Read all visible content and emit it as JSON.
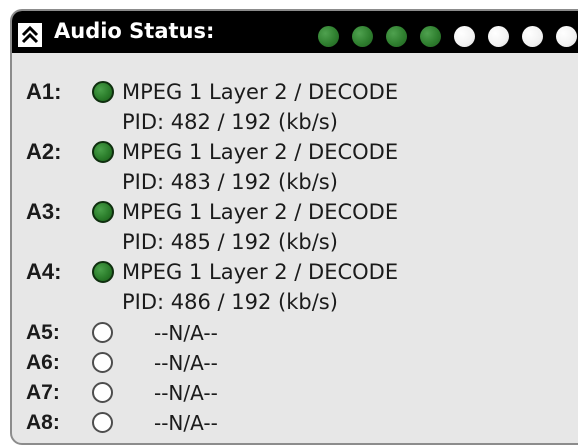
{
  "header": {
    "title": "Audio Status:",
    "indicators": [
      {
        "state": "on"
      },
      {
        "state": "on"
      },
      {
        "state": "on"
      },
      {
        "state": "on"
      },
      {
        "state": "off"
      },
      {
        "state": "off"
      },
      {
        "state": "off"
      },
      {
        "state": "off"
      }
    ]
  },
  "channels": [
    {
      "label": "A1:",
      "state": "on",
      "line1": "MPEG 1 Layer 2 / DECODE",
      "line2": "PID: 482 / 192 (kb/s)"
    },
    {
      "label": "A2:",
      "state": "on",
      "line1": "MPEG 1 Layer 2 / DECODE",
      "line2": "PID: 483 / 192 (kb/s)"
    },
    {
      "label": "A3:",
      "state": "on",
      "line1": "MPEG 1 Layer 2 / DECODE",
      "line2": "PID: 485 / 192 (kb/s)"
    },
    {
      "label": "A4:",
      "state": "on",
      "line1": "MPEG 1 Layer 2 / DECODE",
      "line2": "PID: 486 / 192 (kb/s)"
    },
    {
      "label": "A5:",
      "state": "off",
      "text": "--N/A--"
    },
    {
      "label": "A6:",
      "state": "off",
      "text": "--N/A--"
    },
    {
      "label": "A7:",
      "state": "off",
      "text": "--N/A--"
    },
    {
      "label": "A8:",
      "state": "off",
      "text": "--N/A--"
    }
  ],
  "colors": {
    "header_bg": "#000000",
    "panel_bg": "#e7e7e7",
    "active_green": "#2b7d2b",
    "inactive": "#ffffff"
  },
  "icons": {
    "collapse": "double-chevron-up-icon"
  }
}
